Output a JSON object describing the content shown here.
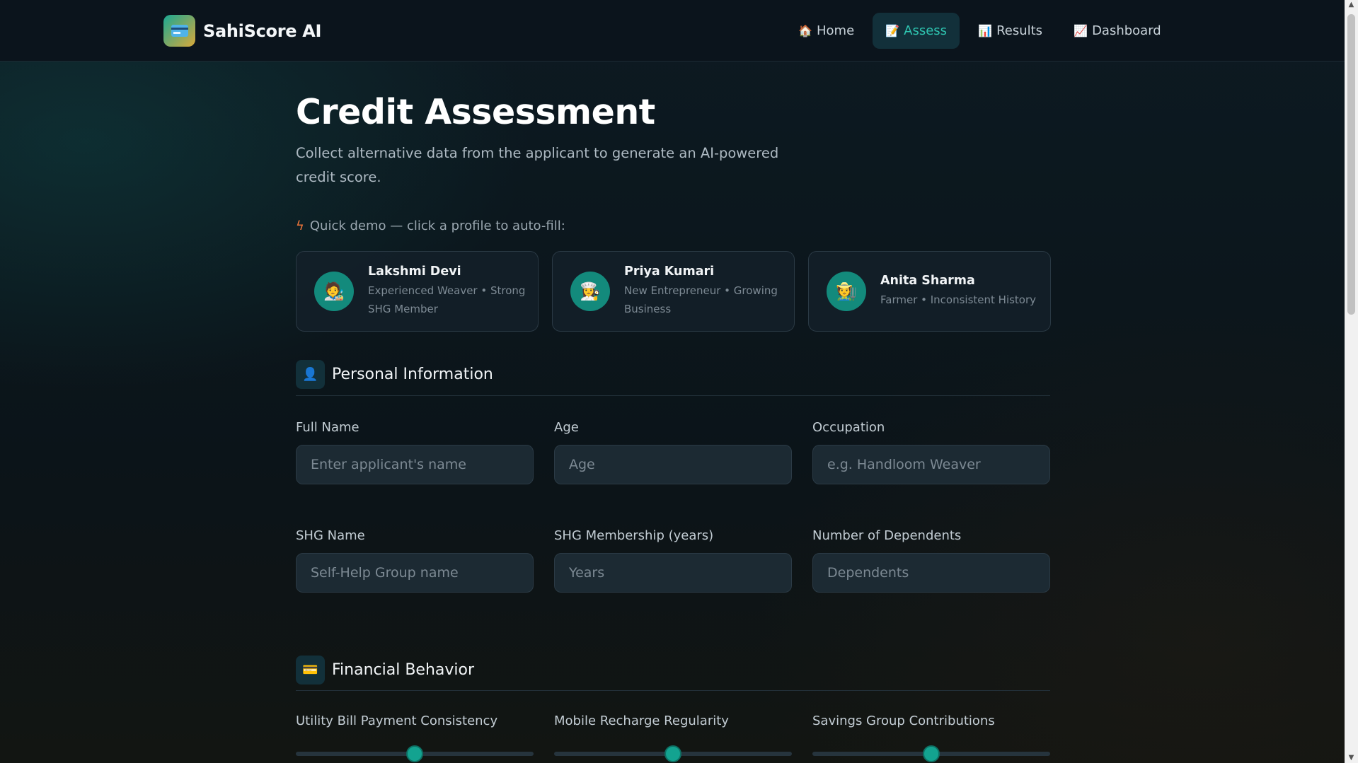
{
  "nav": {
    "brand": "SahiScore AI",
    "links": [
      {
        "icon": "🏠",
        "label": "Home"
      },
      {
        "icon": "📝",
        "label": "Assess"
      },
      {
        "icon": "📊",
        "label": "Results"
      },
      {
        "icon": "📈",
        "label": "Dashboard"
      }
    ],
    "active": "Assess"
  },
  "page": {
    "title": "Credit Assessment",
    "subtitle": "Collect alternative data from the applicant to generate an AI-powered credit score.",
    "demo_label": "Quick demo — click a profile to auto-fill:"
  },
  "profiles": [
    {
      "name": "Lakshmi Devi",
      "desc": "Experienced Weaver • Strong SHG Member",
      "avatar": "🧑‍🎨"
    },
    {
      "name": "Priya Kumari",
      "desc": "New Entrepreneur • Growing Business",
      "avatar": "👩‍🍳"
    },
    {
      "name": "Anita Sharma",
      "desc": "Farmer • Inconsistent History",
      "avatar": "🧑‍🌾"
    }
  ],
  "personal": {
    "title": "Personal Information",
    "icon": "👤",
    "fields": [
      {
        "label": "Full Name",
        "placeholder": "Enter applicant's name"
      },
      {
        "label": "Age",
        "placeholder": "Age"
      },
      {
        "label": "Occupation",
        "placeholder": "e.g. Handloom Weaver"
      },
      {
        "label": "SHG Name",
        "placeholder": "Self-Help Group name"
      },
      {
        "label": "SHG Membership (years)",
        "placeholder": "Years"
      },
      {
        "label": "Number of Dependents",
        "placeholder": "Dependents"
      }
    ]
  },
  "financial": {
    "title": "Financial Behavior",
    "icon": "💳",
    "sliders": [
      {
        "label": "Utility Bill Payment Consistency",
        "value": 0.5
      },
      {
        "label": "Mobile Recharge Regularity",
        "value": 0.5
      },
      {
        "label": "Savings Group Contributions",
        "value": 0.5
      }
    ]
  },
  "colors": {
    "accent": "#2ec4b0",
    "background": "#0c151d",
    "thumb": "#13a390"
  }
}
